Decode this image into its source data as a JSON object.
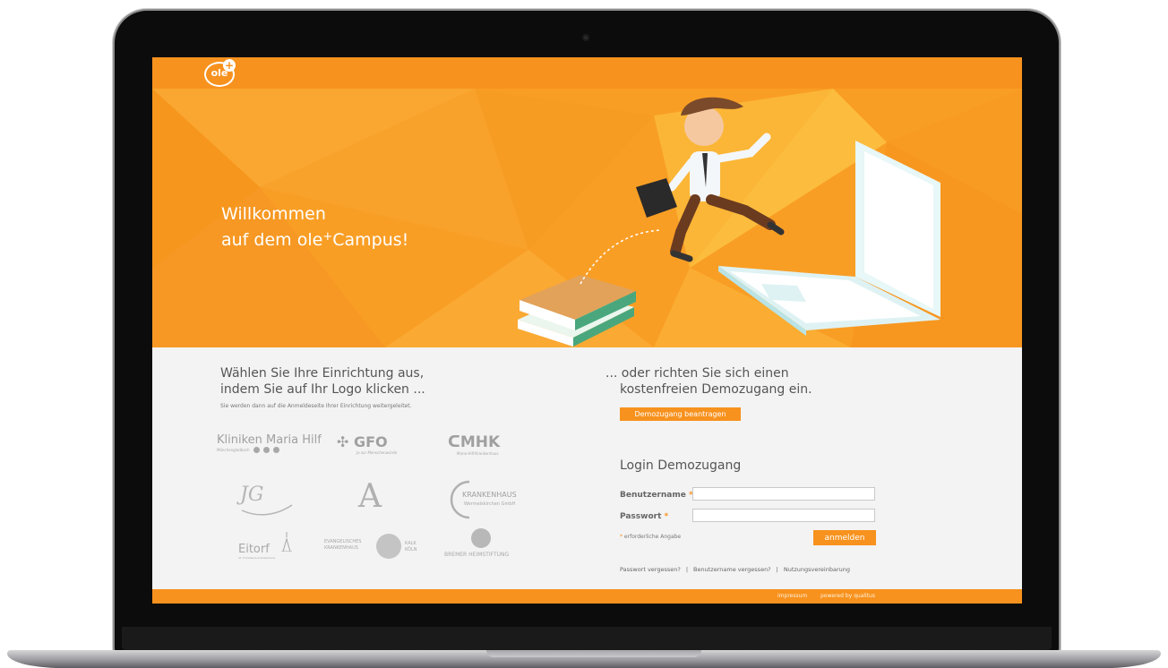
{
  "header": {
    "logo_text": "ole",
    "logo_plus": "+"
  },
  "hero": {
    "title_line1": "Willkommen",
    "title_line2_prefix": "auf dem ole",
    "title_line2_sup": "+",
    "title_line2_suffix": "Campus!"
  },
  "institutions": {
    "heading_line1": "Wählen Sie Ihre Einrichtung aus,",
    "heading_line2": "indem Sie auf Ihr Logo klicken ...",
    "subtext": "Sie werden dann auf die Anmeldeseite Ihrer Einrichtung weitergeleitet.",
    "logos": [
      {
        "name": "Kliniken Maria Hilf",
        "sub": "Mönchengladbach"
      },
      {
        "name": "GFO",
        "sub": "Ja zur Menschenwürde"
      },
      {
        "name": "MHK",
        "sub": "Maria-Hilf-Krankenhaus"
      },
      {
        "name": "JG",
        "sub": ""
      },
      {
        "name": "A",
        "sub": ""
      },
      {
        "name": "KRANKENHAUS",
        "sub": "Wermelskirchen GmbH"
      },
      {
        "name": "Eitorf",
        "sub": "St. Franziskus-Krankenhaus"
      },
      {
        "name": "EVANGELISCHES KRANKENHAUS",
        "sub": "KALK KÖLN"
      },
      {
        "name": "BREMER HEIMSTIFTUNG",
        "sub": ""
      }
    ]
  },
  "demo": {
    "heading_line1": "... oder richten Sie sich einen",
    "heading_line2": "kostenfreien Demozugang ein.",
    "request_button": "Demozugang beantragen"
  },
  "login": {
    "title": "Login Demozugang",
    "username_label": "Benutzername",
    "password_label": "Passwort",
    "required_marker": "*",
    "required_note": "erforderliche Angabe",
    "submit": "anmelden",
    "links": [
      "Passwort vergessen?",
      "Benutzername vergessen?",
      "Nutzungsvereinbarung"
    ],
    "separator": "|"
  },
  "footer": {
    "impressum": "impressum",
    "powered": "powered by qualitus"
  },
  "colors": {
    "accent": "#f7921e",
    "hero_bg": "#f99e25",
    "content_bg": "#f3f3f3",
    "logo_gray": "#a8a8a8"
  }
}
